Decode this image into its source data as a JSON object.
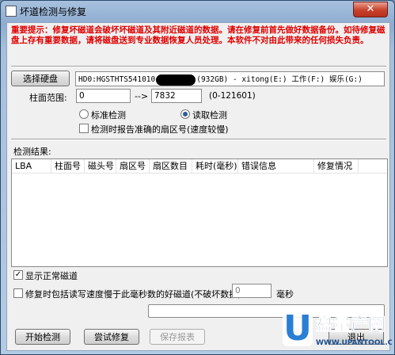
{
  "window": {
    "title": "坏道检测与修复",
    "close": "✕"
  },
  "warning": "重要提示：修复坏磁道会破坏坏磁道及其附近磁道的数据。请在修复前首先做好数据备份。如待修复磁盘上存有重要数据，请将磁盘送到专业数据恢复人员处理。本软件不对由此带来的任何损失负责。",
  "disk": {
    "select_button": "选择硬盘",
    "info_before": "HD0:HGSTHTS541010",
    "info_after": "(932GB) - xitong(E:) 工作(F:) 娱乐(G:)"
  },
  "range": {
    "label": "柱面范围:",
    "from": "0",
    "arrow": "-->",
    "to": "7832",
    "hint": "(0-121601)"
  },
  "mode": {
    "standard": "标准检测",
    "read": "读取检测",
    "selected": "read"
  },
  "report_option": "检测时报告准确的扇区号(速度较慢)",
  "results": {
    "label": "检测结果:",
    "columns": [
      "LBA",
      "柱面号",
      "磁头号",
      "扇区号",
      "扇区数目",
      "耗时(毫秒)",
      "错误信息",
      "修复情况"
    ]
  },
  "show_normal": "显示正常磁道",
  "repair_option": {
    "label": "修复时包括读写速度慢于此毫秒数的好磁道(不破坏数据):",
    "value": "0",
    "unit": "毫秒"
  },
  "buttons": {
    "start": "开始检测",
    "try_repair": "尝试修复",
    "save_report": "保存报表",
    "exit": "退出"
  },
  "logo": {
    "chars": "盘量产网",
    "url": "WWW.UPANTOOL.COM",
    "letter": "U"
  }
}
